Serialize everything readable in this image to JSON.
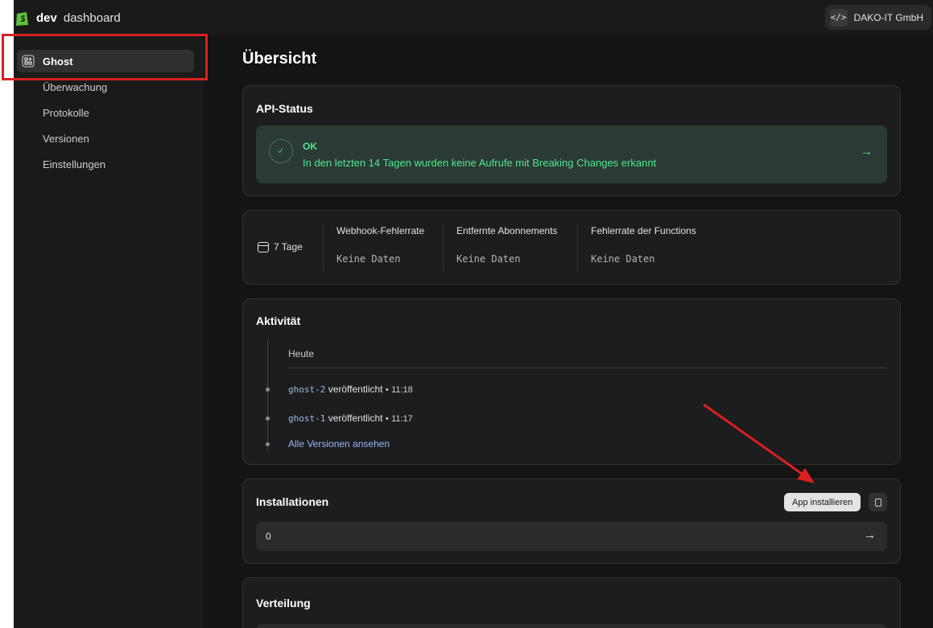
{
  "brand": {
    "bold": "dev",
    "rest": "dashboard"
  },
  "org": {
    "icon": "code-icon",
    "name": "DAKO-IT GmbH"
  },
  "sidebar": {
    "items": [
      {
        "label": "Ghost",
        "icon": "apps-icon",
        "active": true
      },
      {
        "label": "Überwachung"
      },
      {
        "label": "Protokolle"
      },
      {
        "label": "Versionen"
      },
      {
        "label": "Einstellungen"
      }
    ]
  },
  "page": {
    "title": "Übersicht"
  },
  "api_status": {
    "title": "API-Status",
    "status": "OK",
    "message": "In den letzten 14 Tagen wurden keine Aufrufe mit Breaking Changes erkannt",
    "arrow": "→"
  },
  "metrics": {
    "period": "7 Tage",
    "columns": [
      {
        "label": "Webhook-Fehlerrate",
        "value": "Keine Daten"
      },
      {
        "label": "Entfernte Abonnements",
        "value": "Keine Daten"
      },
      {
        "label": "Fehlerrate der Functions",
        "value": "Keine Daten"
      }
    ]
  },
  "activity": {
    "title": "Aktivität",
    "group": "Heute",
    "items": [
      {
        "code": "ghost-2",
        "text": "veröffentlicht",
        "sep": "•",
        "time": "11:18"
      },
      {
        "code": "ghost-1",
        "text": "veröffentlicht",
        "sep": "•",
        "time": "11:17"
      }
    ],
    "link": "Alle Versionen ansehen"
  },
  "installations": {
    "title": "Installationen",
    "button": "App installieren",
    "count": "0",
    "arrow": "→"
  },
  "distribution": {
    "title": "Verteilung"
  },
  "colors": {
    "accent_ok": "#4ee78f",
    "annotation_red": "#d92020"
  }
}
